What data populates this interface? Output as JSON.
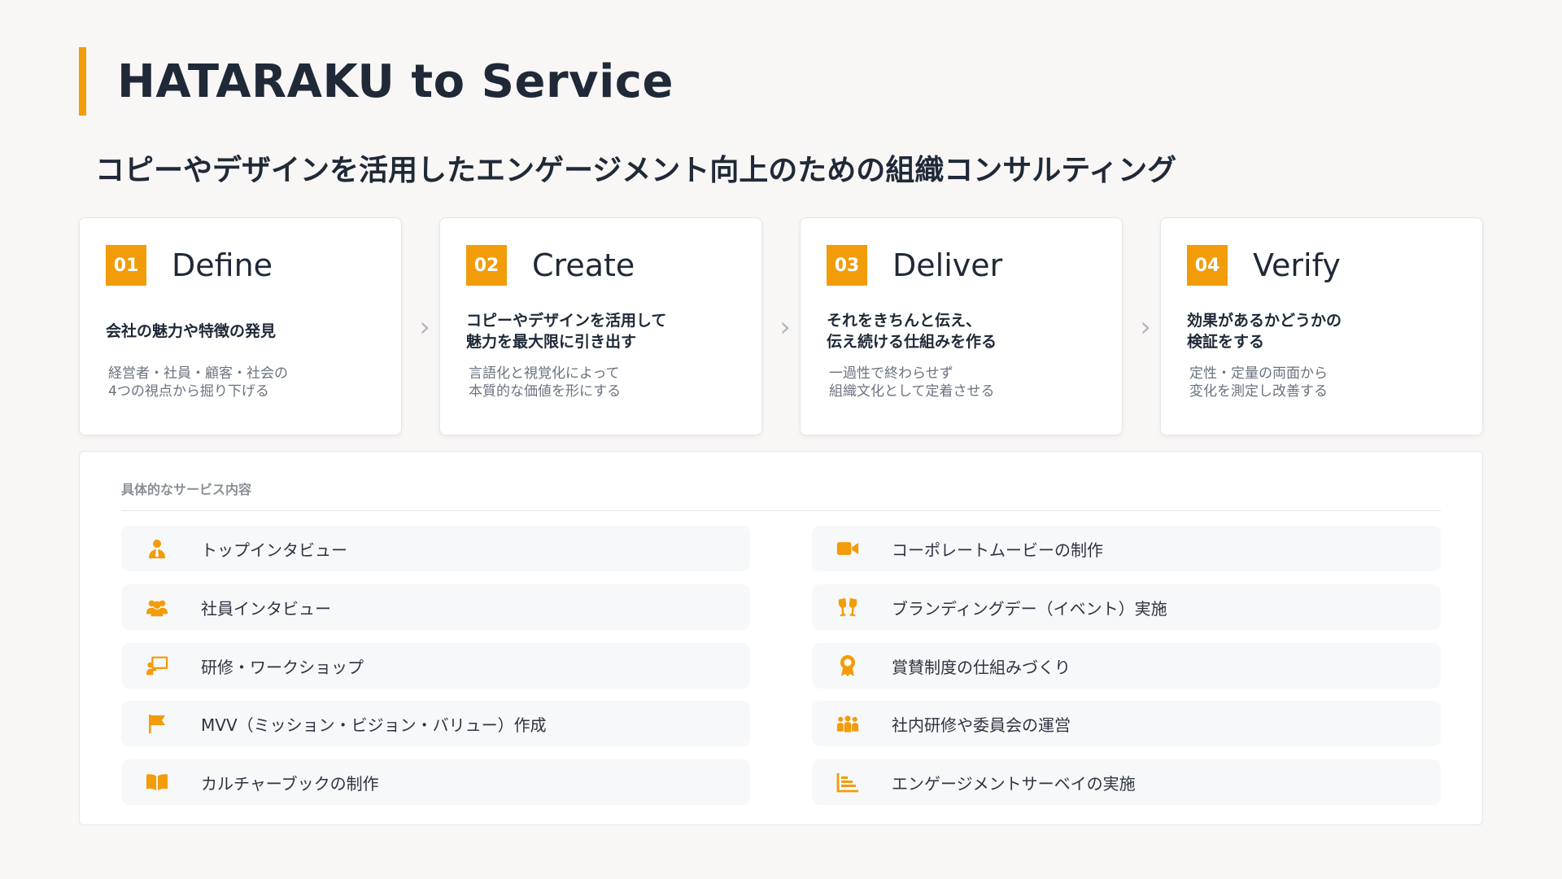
{
  "page": {
    "title": "HATARAKU to Service",
    "subtitle": "コピーやデザインを活用したエンゲージメント向上のための組織コンサルティング"
  },
  "colors": {
    "accent": "#f29c0a",
    "text": "#1f2937",
    "muted": "#6b7280"
  },
  "steps": [
    {
      "num": "01",
      "title": "Define",
      "head": "会社の魅力や特徴の発見",
      "desc": "経営者・社員・顧客・社会の\n4つの視点から掘り下げる"
    },
    {
      "num": "02",
      "title": "Create",
      "head": "コピーやデザインを活用して\n魅力を最大限に引き出す",
      "desc": "言語化と視覚化によって\n本質的な価値を形にする"
    },
    {
      "num": "03",
      "title": "Deliver",
      "head": "それをきちんと伝え、\n伝え続ける仕組みを作る",
      "desc": "一過性で終わらせず\n組織文化として定着させる"
    },
    {
      "num": "04",
      "title": "Verify",
      "head": "効果があるかどうかの\n検証をする",
      "desc": "定性・定量の両面から\n変化を測定し改善する"
    }
  ],
  "services": {
    "label": "具体的なサービス内容",
    "left": [
      {
        "icon": "person-tie-icon",
        "text": "トップインタビュー"
      },
      {
        "icon": "users-icon",
        "text": "社員インタビュー"
      },
      {
        "icon": "presentation-icon",
        "text": "研修・ワークショップ"
      },
      {
        "icon": "flag-icon",
        "text": "MVV（ミッション・ビジョン・バリュー）作成"
      },
      {
        "icon": "book-open-icon",
        "text": "カルチャーブックの制作"
      }
    ],
    "right": [
      {
        "icon": "video-camera-icon",
        "text": "コーポレートムービーの制作"
      },
      {
        "icon": "glasses-cheers-icon",
        "text": "ブランディングデー（イベント）実施"
      },
      {
        "icon": "award-icon",
        "text": "賞賛制度の仕組みづくり"
      },
      {
        "icon": "people-group-icon",
        "text": "社内研修や委員会の運営"
      },
      {
        "icon": "chart-bar-icon",
        "text": "エンゲージメントサーベイの実施"
      }
    ]
  }
}
